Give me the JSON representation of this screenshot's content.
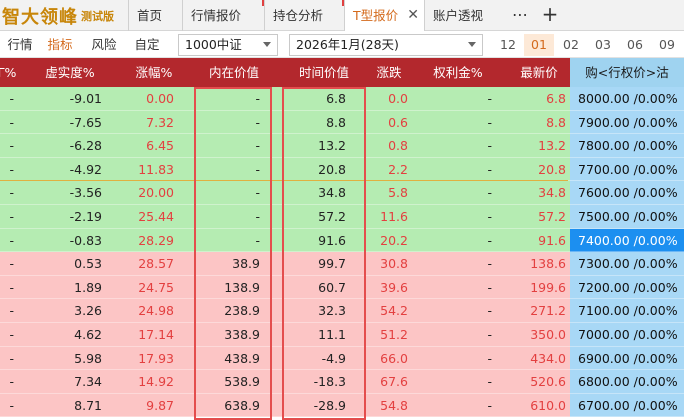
{
  "brand": {
    "name": "智大领峰",
    "tag": "测试版"
  },
  "tabs": [
    {
      "label": "首页"
    },
    {
      "label": "行情报价"
    },
    {
      "label": "持仓分析"
    },
    {
      "label": "T型报价"
    },
    {
      "label": "账户透视"
    }
  ],
  "toolbar": {
    "views": [
      "行情",
      "指标",
      "风险",
      "自定"
    ],
    "active_view": "指标",
    "underlying": "1000中证",
    "expiry": "2026年1月(28天)",
    "months": [
      "12",
      "01",
      "02",
      "03",
      "06",
      "09"
    ],
    "active_month": "01",
    "more_icon": "more-dots-icon",
    "add_icon": "plus-icon",
    "close_icon": "close-x-icon"
  },
  "grid": {
    "columns": [
      "Γ%",
      "虚实度%",
      "涨幅%",
      "内在价值",
      "时间价值",
      "涨跌",
      "权利金%",
      "最新价",
      "购<行权价>沽"
    ],
    "rows": [
      {
        "c0": "-",
        "moneyness": "-9.01",
        "pct": "0.00",
        "intrinsic": "-",
        "timeval": "6.8",
        "chg": "0.0",
        "prem": "-",
        "last": "6.8",
        "strike": "8000.00 /0.00%"
      },
      {
        "c0": "-",
        "moneyness": "-7.65",
        "pct": "7.32",
        "intrinsic": "-",
        "timeval": "8.8",
        "chg": "0.6",
        "prem": "-",
        "last": "8.8",
        "strike": "7900.00 /0.00%"
      },
      {
        "c0": "-",
        "moneyness": "-6.28",
        "pct": "6.45",
        "intrinsic": "-",
        "timeval": "13.2",
        "chg": "0.8",
        "prem": "-",
        "last": "13.2",
        "strike": "7800.00 /0.00%"
      },
      {
        "c0": "-",
        "moneyness": "-4.92",
        "pct": "11.83",
        "intrinsic": "-",
        "timeval": "20.8",
        "chg": "2.2",
        "prem": "-",
        "last": "20.8",
        "strike": "7700.00 /0.00%"
      },
      {
        "c0": "-",
        "moneyness": "-3.56",
        "pct": "20.00",
        "intrinsic": "-",
        "timeval": "34.8",
        "chg": "5.8",
        "prem": "-",
        "last": "34.8",
        "strike": "7600.00 /0.00%"
      },
      {
        "c0": "-",
        "moneyness": "-2.19",
        "pct": "25.44",
        "intrinsic": "-",
        "timeval": "57.2",
        "chg": "11.6",
        "prem": "-",
        "last": "57.2",
        "strike": "7500.00 /0.00%"
      },
      {
        "c0": "-",
        "moneyness": "-0.83",
        "pct": "28.29",
        "intrinsic": "-",
        "timeval": "91.6",
        "chg": "20.2",
        "prem": "-",
        "last": "91.6",
        "strike": "7400.00 /0.00%"
      },
      {
        "c0": "-",
        "moneyness": "0.53",
        "pct": "28.57",
        "intrinsic": "38.9",
        "timeval": "99.7",
        "chg": "30.8",
        "prem": "-",
        "last": "138.6",
        "strike": "7300.00 /0.00%"
      },
      {
        "c0": "-",
        "moneyness": "1.89",
        "pct": "24.75",
        "intrinsic": "138.9",
        "timeval": "60.7",
        "chg": "39.6",
        "prem": "-",
        "last": "199.6",
        "strike": "7200.00 /0.00%"
      },
      {
        "c0": "-",
        "moneyness": "3.26",
        "pct": "24.98",
        "intrinsic": "238.9",
        "timeval": "32.3",
        "chg": "54.2",
        "prem": "-",
        "last": "271.2",
        "strike": "7100.00 /0.00%"
      },
      {
        "c0": "-",
        "moneyness": "4.62",
        "pct": "17.14",
        "intrinsic": "338.9",
        "timeval": "11.1",
        "chg": "51.2",
        "prem": "-",
        "last": "350.0",
        "strike": "7000.00 /0.00%"
      },
      {
        "c0": "-",
        "moneyness": "5.98",
        "pct": "17.93",
        "intrinsic": "438.9",
        "timeval": "-4.9",
        "chg": "66.0",
        "prem": "-",
        "last": "434.0",
        "strike": "6900.00 /0.00%"
      },
      {
        "c0": "-",
        "moneyness": "7.34",
        "pct": "14.92",
        "intrinsic": "538.9",
        "timeval": "-18.3",
        "chg": "67.6",
        "prem": "-",
        "last": "520.6",
        "strike": "6800.00 /0.00%"
      },
      {
        "c0": "-",
        "moneyness": "8.71",
        "pct": "9.87",
        "intrinsic": "638.9",
        "timeval": "-28.9",
        "chg": "54.8",
        "prem": "-",
        "last": "610.0",
        "strike": "6700.00 /0.00%"
      }
    ],
    "selected_strike_row": 6,
    "colors": {
      "otm_row": "#b5ecb2",
      "itm_row": "#fcc5c5",
      "header": "#b3282d",
      "up": "#e34040",
      "strike_col": "#a8d8f6",
      "selected": "#1c8ff0",
      "highlight_box": "#e44d4d"
    }
  }
}
